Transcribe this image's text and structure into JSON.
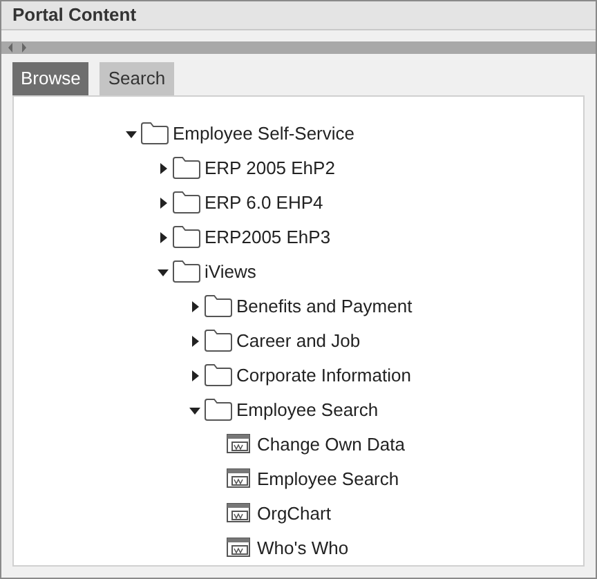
{
  "panel": {
    "title": "Portal Content"
  },
  "tabs": [
    {
      "label": "Browse",
      "selected": true
    },
    {
      "label": "Search",
      "selected": false
    }
  ],
  "tree": [
    {
      "kind": "folder",
      "label": "Employee Self-Service",
      "expanded": true,
      "children": [
        {
          "kind": "folder",
          "label": "ERP 2005 EhP2",
          "expanded": false
        },
        {
          "kind": "folder",
          "label": "ERP 6.0 EHP4",
          "expanded": false
        },
        {
          "kind": "folder",
          "label": "ERP2005 EhP3",
          "expanded": false
        },
        {
          "kind": "folder",
          "label": "iViews",
          "expanded": true,
          "children": [
            {
              "kind": "folder",
              "label": "Benefits and Payment",
              "expanded": false
            },
            {
              "kind": "folder",
              "label": "Career and Job",
              "expanded": false
            },
            {
              "kind": "folder",
              "label": "Corporate Information",
              "expanded": false
            },
            {
              "kind": "folder",
              "label": "Employee Search",
              "expanded": true,
              "children": [
                {
                  "kind": "iview",
                  "label": "Change Own Data"
                },
                {
                  "kind": "iview",
                  "label": "Employee Search"
                },
                {
                  "kind": "iview",
                  "label": "OrgChart"
                },
                {
                  "kind": "iview",
                  "label": "Who's Who"
                }
              ]
            }
          ]
        }
      ]
    }
  ]
}
